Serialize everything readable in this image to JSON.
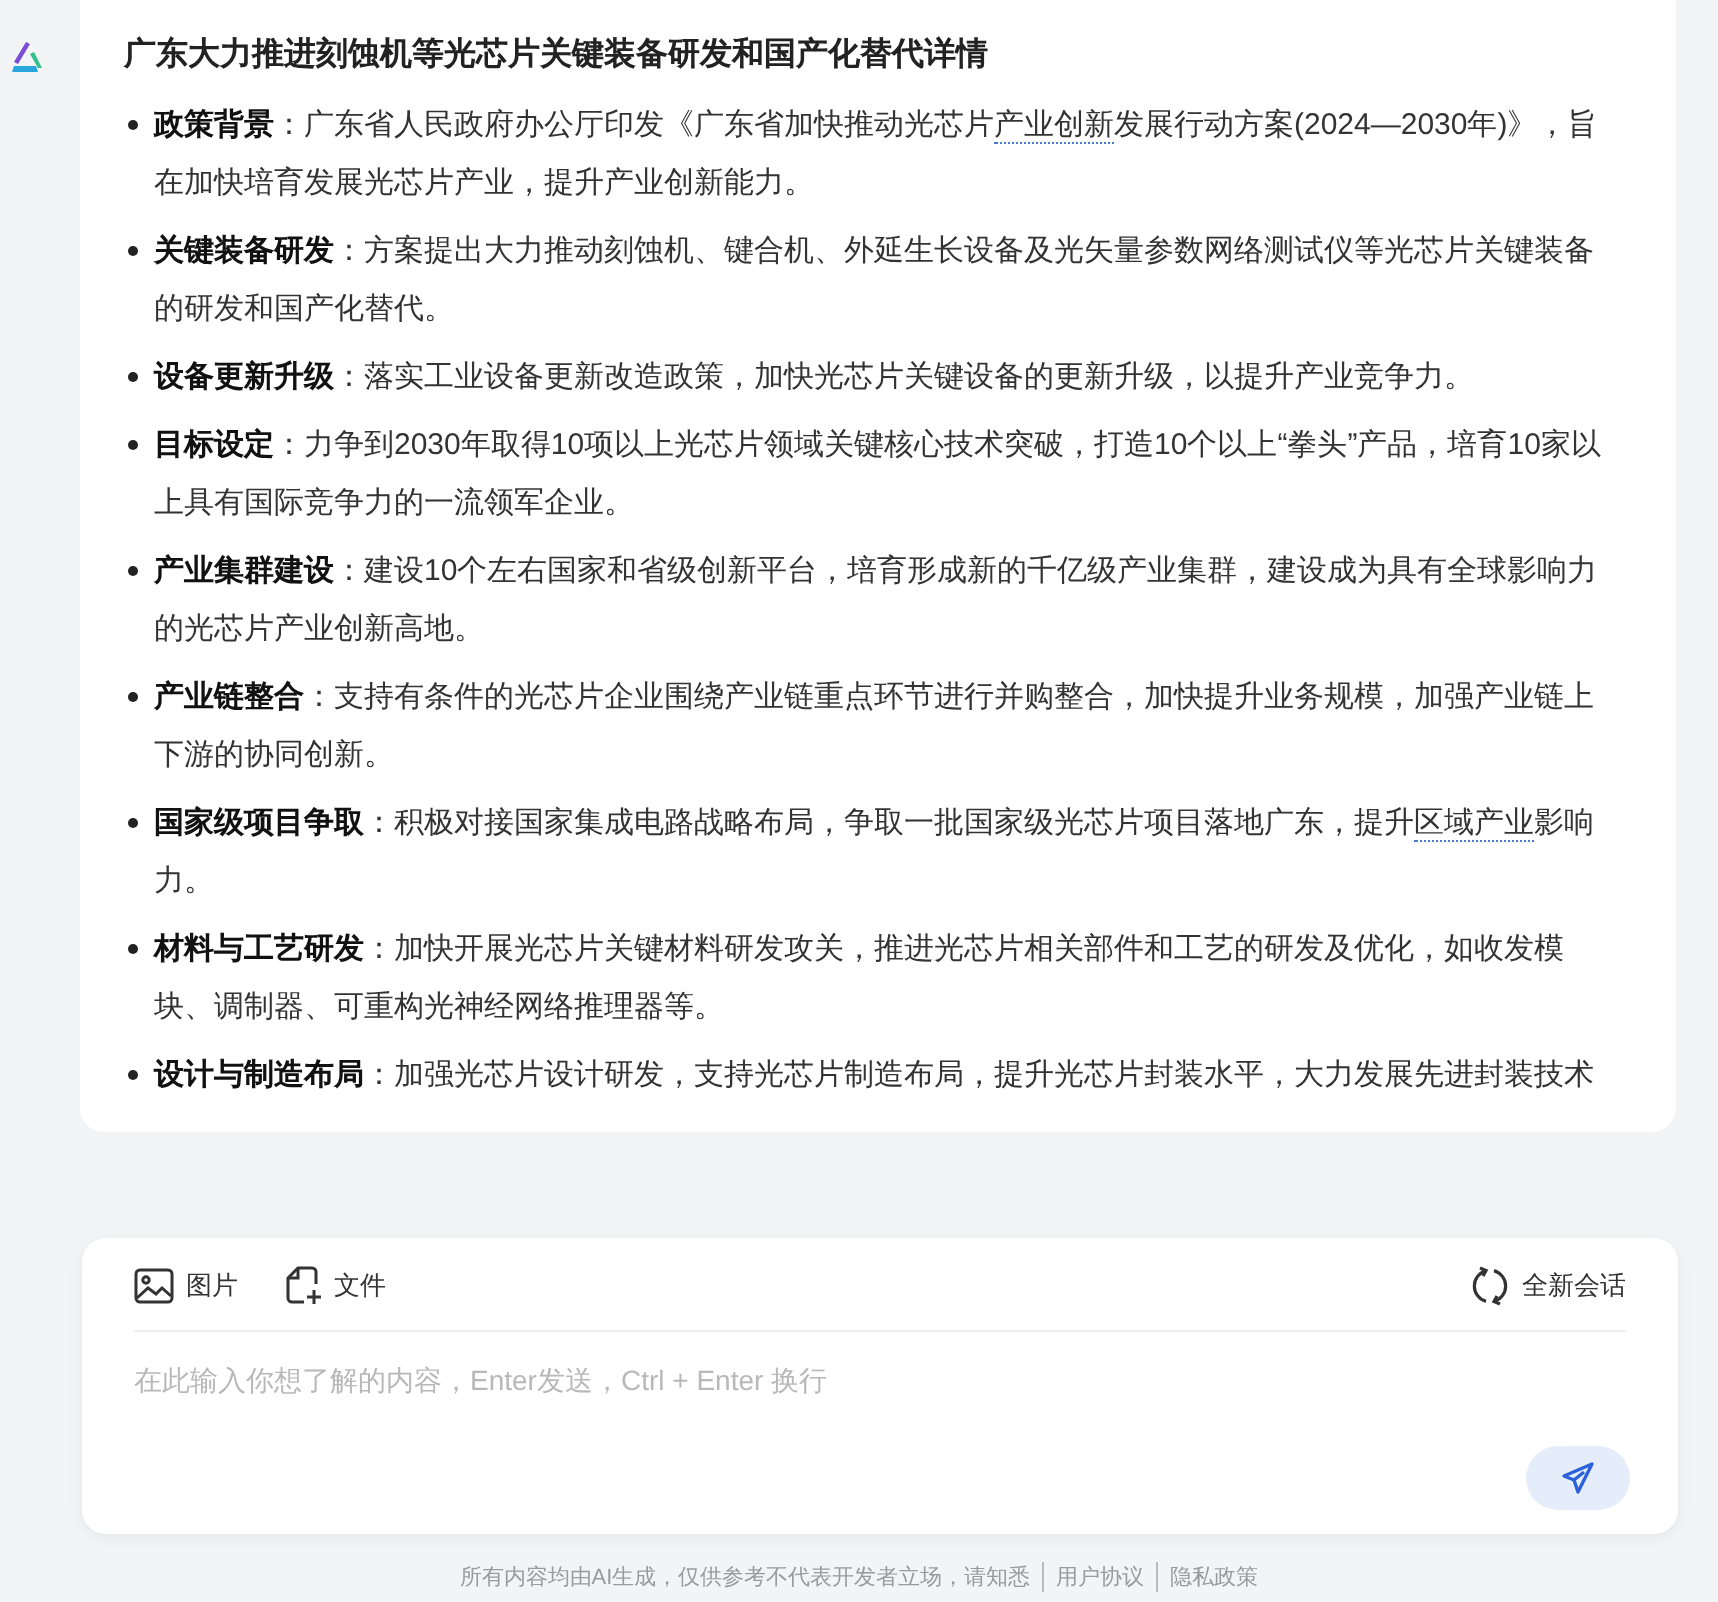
{
  "answer": {
    "title": "广东大力推进刻蚀机等光芯片关键装备研发和国产化替代详情",
    "items": [
      {
        "label": "政策背景",
        "segments": [
          {
            "kind": "plain",
            "text": "：广东省人民政府办公厅印发《广东省加快推动光芯片"
          },
          {
            "kind": "term",
            "text": "产业创新"
          },
          {
            "kind": "plain",
            "text": "发展行动方案(2024—2030年)》，旨在加快培育发展光芯片产业，提升产业创新能力。"
          }
        ]
      },
      {
        "label": "关键装备研发",
        "segments": [
          {
            "kind": "plain",
            "text": "：方案提出大力推动刻蚀机、键合机、外延生长设备及光矢量参数网络测试仪等光芯片关键装备的研发和国产化替代。"
          }
        ]
      },
      {
        "label": "设备更新升级",
        "segments": [
          {
            "kind": "plain",
            "text": "：落实工业设备更新改造政策，加快光芯片关键设备的更新升级，以提升产业竞争力。"
          }
        ]
      },
      {
        "label": "目标设定",
        "segments": [
          {
            "kind": "plain",
            "text": "：力争到2030年取得10项以上光芯片领域关键核心技术突破，打造10个以上“拳头”产品，培育10家以上具有国际竞争力的一流领军企业。"
          }
        ]
      },
      {
        "label": "产业集群建设",
        "segments": [
          {
            "kind": "plain",
            "text": "：建设10个左右国家和省级创新平台，培育形成新的千亿级产业集群，建设成为具有全球影响力的光芯片产业创新高地。"
          }
        ]
      },
      {
        "label": "产业链整合",
        "segments": [
          {
            "kind": "plain",
            "text": "：支持有条件的光芯片企业围绕产业链重点环节进行并购整合，加快提升业务规模，加强产业链上下游的协同创新。"
          }
        ]
      },
      {
        "label": "国家级项目争取",
        "segments": [
          {
            "kind": "plain",
            "text": "：积极对接国家集成电路战略布局，争取一批国家级光芯片项目落地广东，提升"
          },
          {
            "kind": "term",
            "text": "区域产业"
          },
          {
            "kind": "plain",
            "text": "影响力。"
          }
        ]
      },
      {
        "label": "材料与工艺研发",
        "segments": [
          {
            "kind": "plain",
            "text": "：加快开展光芯片关键材料研发攻关，推进光芯片相关部件和工艺的研发及优化，如收发模块、调制器、可重构光神经网络推理器等。"
          }
        ]
      },
      {
        "label": "设计与制造布局",
        "segments": [
          {
            "kind": "plain",
            "text": "：加强光芯片设计研发，支持光芯片制造布局，提升光芯片封装水平，大力发展先进封装技术"
          }
        ]
      }
    ]
  },
  "composer": {
    "tools": [
      {
        "kind": "image",
        "label": "图片"
      },
      {
        "kind": "file",
        "label": "文件"
      }
    ],
    "new_chat": "全新会话",
    "placeholder": "在此输入你想了解的内容，Enter发送，Ctrl + Enter 换行"
  },
  "footer": {
    "notice": "所有内容均由AI生成，仅供参考不代表开发者立场，请知悉",
    "links": [
      "用户协议",
      "隐私政策"
    ]
  }
}
